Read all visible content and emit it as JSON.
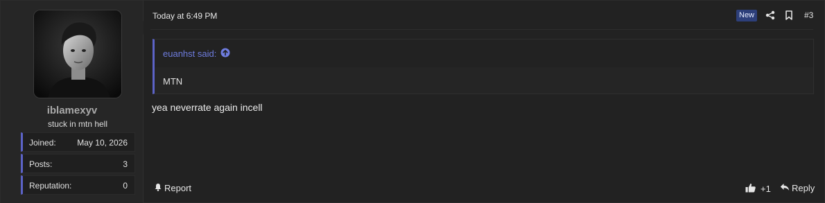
{
  "user": {
    "username": "iblamexyv",
    "title": "stuck in mtn hell",
    "stats": [
      {
        "label": "Joined:",
        "value": "May 10, 2026"
      },
      {
        "label": "Posts:",
        "value": "3"
      },
      {
        "label": "Reputation:",
        "value": "0"
      }
    ]
  },
  "post": {
    "timestamp": "Today at 6:49 PM",
    "new_badge": "New",
    "number": "#3",
    "quote": {
      "author": "euanhst said:",
      "body": "MTN"
    },
    "message": "yea neverrate again incell"
  },
  "actions": {
    "report": "Report",
    "like_count": "+1",
    "reply": "Reply"
  },
  "colors": {
    "accent": "#5c63c7",
    "quote_link": "#6f7de0",
    "badge_bg": "#2d3f7a"
  }
}
